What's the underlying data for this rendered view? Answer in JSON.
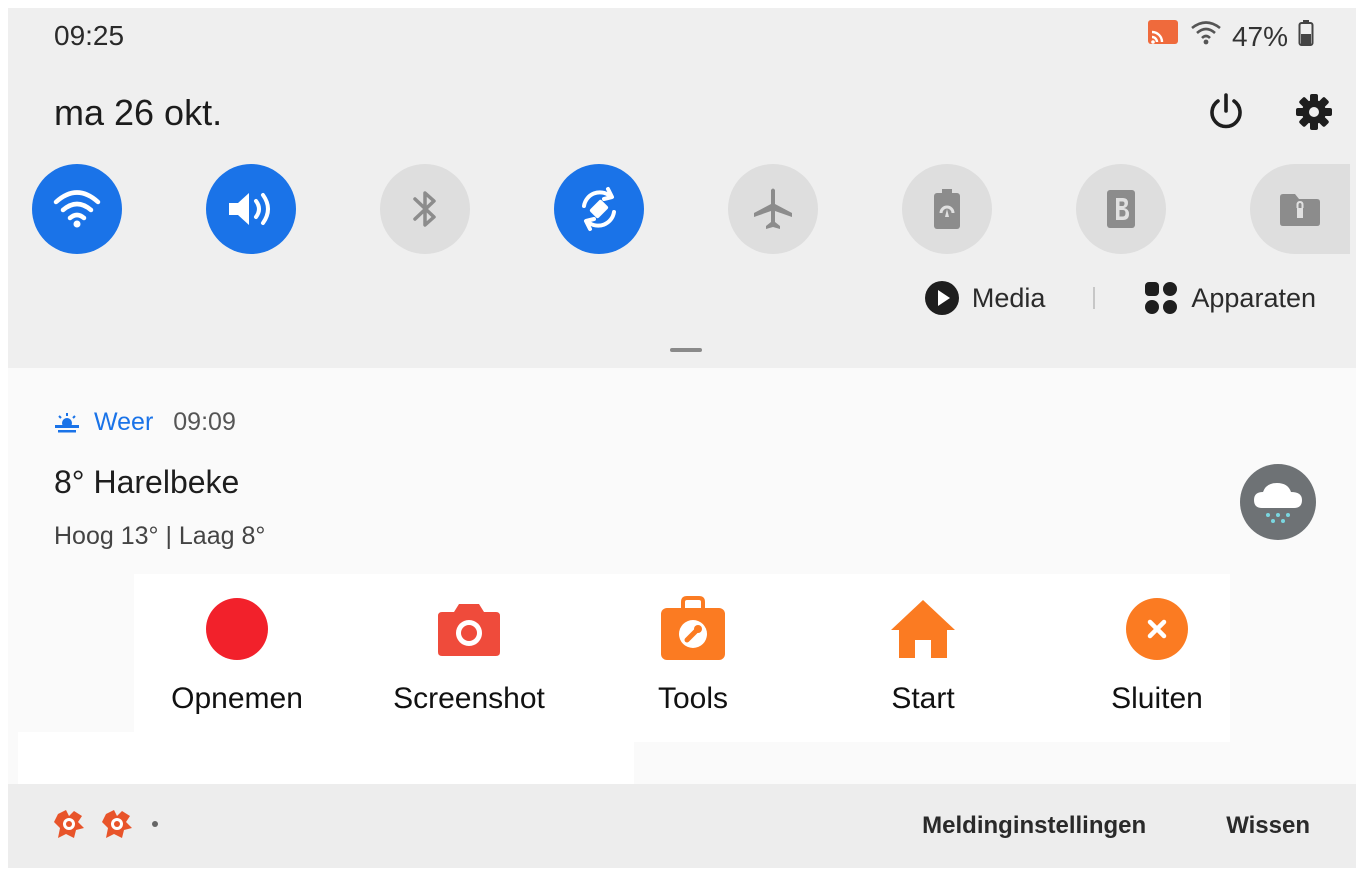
{
  "status_bar": {
    "time": "09:25",
    "battery": "47%"
  },
  "header": {
    "date": "ma 26 okt."
  },
  "quick_tiles": [
    {
      "name": "wifi",
      "state": "on"
    },
    {
      "name": "sound",
      "state": "on"
    },
    {
      "name": "bluetooth",
      "state": "off"
    },
    {
      "name": "auto-rotate",
      "state": "on"
    },
    {
      "name": "airplane-mode",
      "state": "off"
    },
    {
      "name": "power-saving",
      "state": "off"
    },
    {
      "name": "b-tile",
      "state": "off"
    },
    {
      "name": "secure-folder",
      "state": "off"
    }
  ],
  "sub_actions": {
    "media": "Media",
    "devices": "Apparaten"
  },
  "notification": {
    "app": "Weer",
    "time": "09:09",
    "title": "8° Harelbeke",
    "subtitle": "Hoog 13° | Laag 8°"
  },
  "toolbar": {
    "record": "Opnemen",
    "screenshot": "Screenshot",
    "tools": "Tools",
    "home": "Start",
    "close": "Sluiten"
  },
  "bottom_bar": {
    "settings": "Meldinginstellingen",
    "clear": "Wissen"
  },
  "colors": {
    "accent": "#1a73e8",
    "record": "#f2212b",
    "screenshot": "#ef4b3b",
    "orange": "#fb7b22"
  }
}
